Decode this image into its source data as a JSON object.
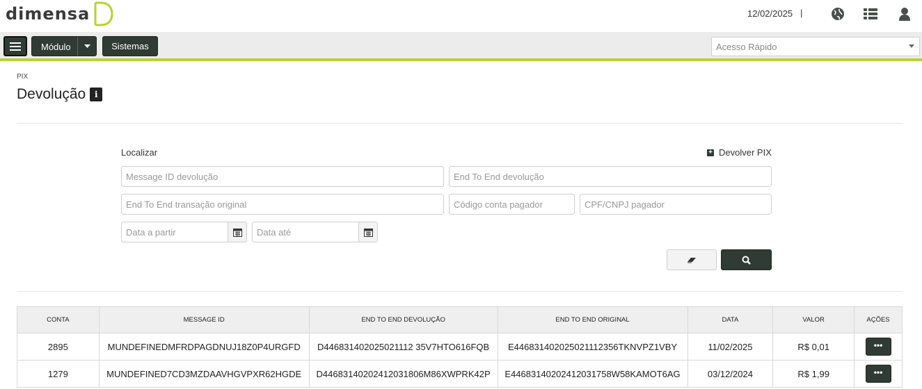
{
  "header": {
    "logo_text": "Dimensa",
    "date": "12/02/2025",
    "separator": "|",
    "icons": [
      "globe-icon",
      "list-icon",
      "user-icon"
    ]
  },
  "toolbar": {
    "menu_icon": "hamburger-icon",
    "modulo_label": "Módulo",
    "sistemas_label": "Sistemas",
    "quick_access_placeholder": "Acesso Rápido"
  },
  "page": {
    "breadcrumb": "PIX",
    "title": "Devolução",
    "info_icon": "i"
  },
  "filter": {
    "heading": "Localizar",
    "devolver_label": "Devolver PIX",
    "fields": {
      "message_id": "Message ID devolução",
      "end_to_end_devolucao": "End To End devolução",
      "end_to_end_original": "End To End transação original",
      "codigo_conta": "Código conta pagador",
      "cpf_cnpj": "CPF/CNPJ pagador",
      "data_a_partir": "Data a partir",
      "data_ate": "Data até"
    }
  },
  "table": {
    "headers": [
      "CONTA",
      "MESSAGE ID",
      "END TO END DEVOLUÇÃO",
      "END TO END ORIGINAL",
      "DATA",
      "VALOR",
      "AÇÕES"
    ],
    "rows": [
      [
        "2895",
        "MUNDEFINEDMFRDPAGDNUJ18Z0P4URGFD",
        "D446831402025021112 35V7HTO616FQB",
        "E446831402025021112356TKNVPZ1VBY",
        "11/02/2025",
        "R$ 0,01",
        "•••"
      ],
      [
        "1279",
        "MUNDEFINED7CD3MZDAAVHGVPXR62HGDE",
        "D44683140202412031806M86XWPRK42P",
        "E44683140202412031758W58KAMOT6AG",
        "03/12/2024",
        "R$ 1,99",
        "•••"
      ]
    ]
  },
  "colors": {
    "accent": "#b5d334",
    "dark_button": "#2f3b34"
  }
}
